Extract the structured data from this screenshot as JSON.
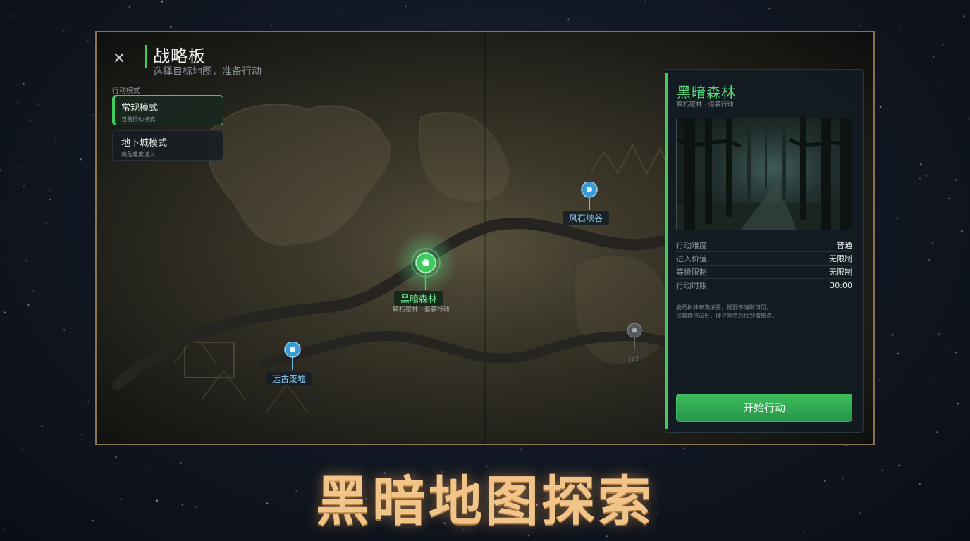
{
  "header": {
    "close_icon": "close-icon",
    "title": "战略板",
    "subtitle": "选择目标地图，准备行动"
  },
  "modes": {
    "label": "行动模式",
    "items": [
      {
        "title": "常规模式",
        "desc": "当前行动模式",
        "active": true
      },
      {
        "title": "地下城模式",
        "desc": "高危难度进入",
        "active": false
      }
    ]
  },
  "map": {
    "locations": [
      {
        "id": "fengshi",
        "name": "风石峡谷",
        "color": "#3a9ad6",
        "state": "available"
      },
      {
        "id": "heian",
        "name": "黑暗森林",
        "sub": "腐朽密林 · 潜袭行动",
        "color": "#3ecb62",
        "state": "selected"
      },
      {
        "id": "yuangu",
        "name": "远古废墟",
        "color": "#3a9ad6",
        "state": "available"
      },
      {
        "id": "unknown",
        "name": "???",
        "color": "#6f7377",
        "state": "locked"
      }
    ]
  },
  "detail": {
    "title": "黑暗森林",
    "subtitle": "腐朽密林 · 潜袭行动",
    "stats": [
      {
        "key": "行动难度",
        "value": "普通"
      },
      {
        "key": "进入价值",
        "value": "无限制"
      },
      {
        "key": "等级限制",
        "value": "无限制"
      },
      {
        "key": "行动时限",
        "value": "30:00"
      }
    ],
    "desc_lines": [
      "腐朽树林布满浓雾，视野不清晰可见。",
      "探索静待深处，搜寻物资后找到撤离点。"
    ],
    "start_button": "开始行动"
  },
  "banner": "黑暗地图探索",
  "colors": {
    "accent": "#3ecb62",
    "frame": "#8a7352",
    "banner": "#f1c48a",
    "pin_blue": "#3a9ad6"
  }
}
